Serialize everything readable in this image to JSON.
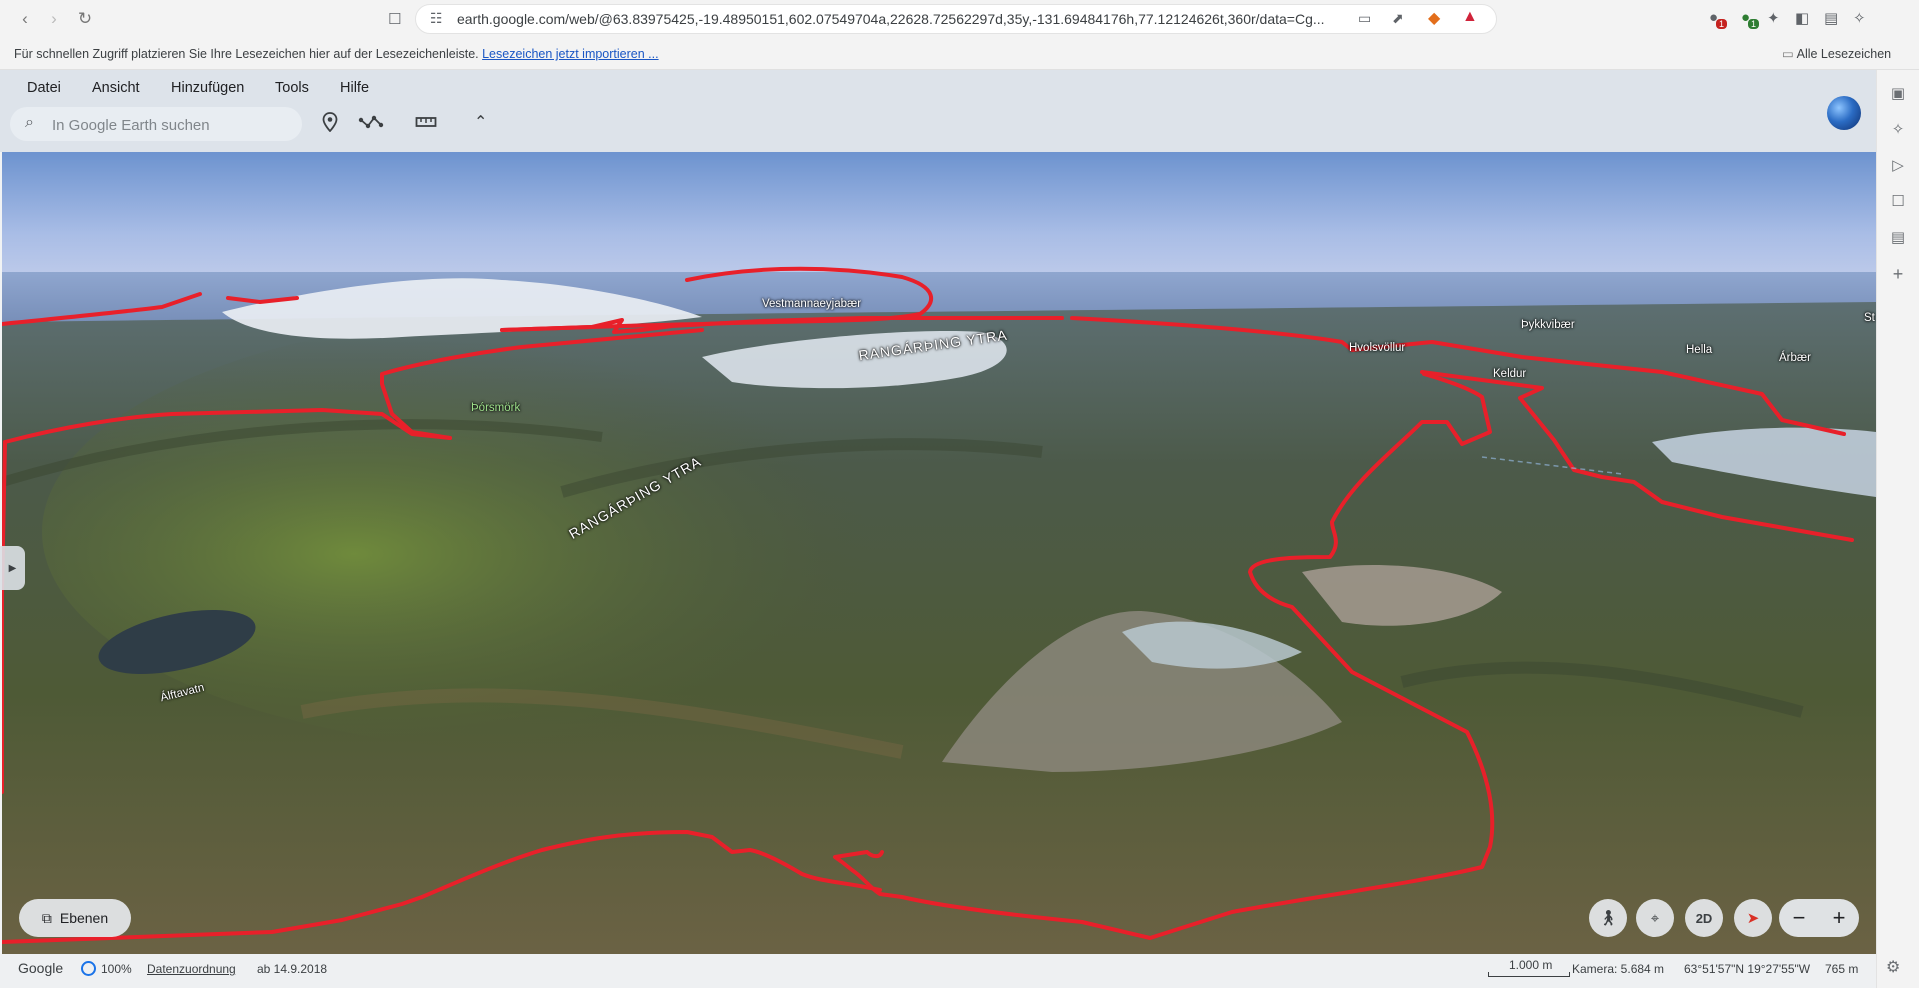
{
  "browser": {
    "url": "earth.google.com/web/@63.83975425,-19.48950151,602.07549704a,22628.72562297d,35y,-131.69484176h,77.12124626t,360r/data=Cg...",
    "ext_badge_1": "1",
    "ext_badge_2": "1"
  },
  "bookmarks": {
    "hint": "Für schnellen Zugriff platzieren Sie Ihre Lesezeichen hier auf der Lesezeichenleiste.",
    "import_link": "Lesezeichen jetzt importieren ...",
    "all_bookmarks": "Alle Lesezeichen"
  },
  "menu": [
    "Datei",
    "Ansicht",
    "Hinzufügen",
    "Tools",
    "Hilfe"
  ],
  "search": {
    "placeholder": "In Google Earth suchen"
  },
  "map": {
    "places": [
      "Vestmannaeyjabær",
      "Hvolsvöllur",
      "Þykkvibær",
      "Hella",
      "Árbær",
      "Keldur",
      "Þórsmörk",
      "Álftavatn",
      "St"
    ],
    "regions": [
      "RANGÁRÞING YTRA",
      "RANGÁRÞING YTRA"
    ],
    "boundary_color": "#e8202a"
  },
  "controls": {
    "layers": "Ebenen",
    "mode_2d": "2D"
  },
  "status": {
    "brand": "Google",
    "loaded": "100%",
    "attribution": "Datenzuordnung",
    "imagery_date": "ab 14.9.2018",
    "scale": "1.000 m",
    "camera": "Kamera: 5.684 m",
    "coords": "63°51'57\"N 19°27'55\"W",
    "elevation": "765 m"
  },
  "icons": [
    "back-icon",
    "forward-icon",
    "reload-icon",
    "bookmark-icon",
    "site-info-icon",
    "cast-icon",
    "share-icon",
    "brave-shield-icon",
    "rewards-icon",
    "extensions-icon",
    "sidebar-icon",
    "wallet-icon",
    "leo-icon",
    "folder-icon",
    "search-icon",
    "placemark-icon",
    "path-icon",
    "ruler-icon",
    "collapse-icon",
    "layers-icon",
    "pegman-icon",
    "location-icon",
    "compass-icon",
    "gear-icon"
  ]
}
